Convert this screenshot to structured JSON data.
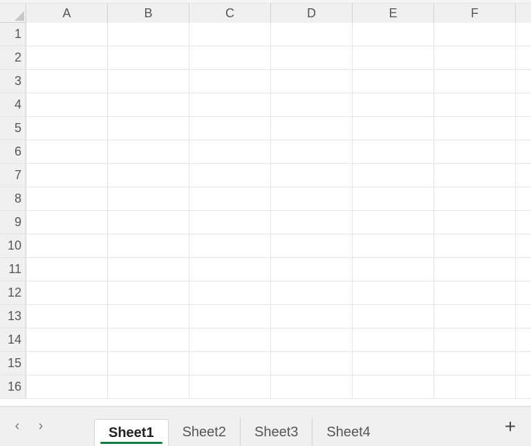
{
  "grid": {
    "columns": [
      "A",
      "B",
      "C",
      "D",
      "E",
      "F"
    ],
    "rows": [
      "1",
      "2",
      "3",
      "4",
      "5",
      "6",
      "7",
      "8",
      "9",
      "10",
      "11",
      "12",
      "13",
      "14",
      "15",
      "16"
    ]
  },
  "tabs": {
    "items": [
      {
        "label": "Sheet1",
        "active": true
      },
      {
        "label": "Sheet2",
        "active": false
      },
      {
        "label": "Sheet3",
        "active": false
      },
      {
        "label": "Sheet4",
        "active": false
      }
    ]
  },
  "nav": {
    "prev_glyph": "‹",
    "next_glyph": "›",
    "add_glyph": "+"
  }
}
